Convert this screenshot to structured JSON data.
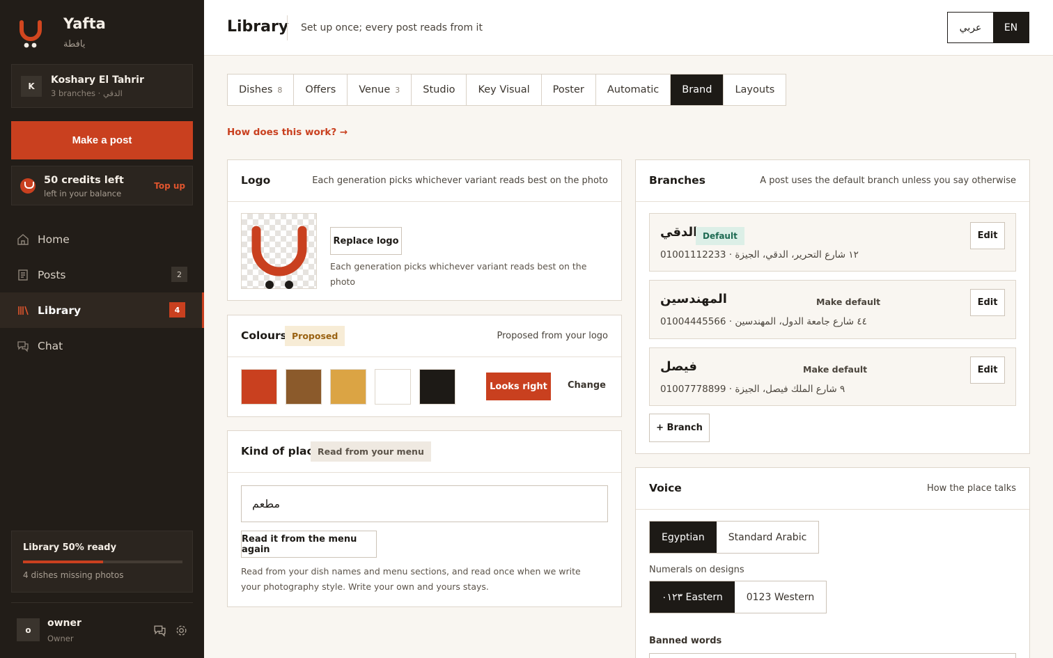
{
  "brand": {
    "name": "Yafta",
    "arabic": "يافطة"
  },
  "account": {
    "initial": "K",
    "name": "Koshary El Tahrir",
    "meta": "3 branches · الدقي"
  },
  "make_post": "Make a post",
  "credits": {
    "title": "50 credits left",
    "subtitle": "left in your balance",
    "topup": "Top up"
  },
  "nav": [
    {
      "label": "Home",
      "icon": "home-icon",
      "badge": ""
    },
    {
      "label": "Posts",
      "icon": "posts-icon",
      "badge": "2"
    },
    {
      "label": "Library",
      "icon": "library-icon",
      "badge": "4",
      "active": true
    },
    {
      "label": "Chat",
      "icon": "chat-icon",
      "badge": ""
    }
  ],
  "library_progress": {
    "title": "Library 50% ready",
    "percent": 50,
    "subtitle": "4 dishes missing photos"
  },
  "user": {
    "initial": "o",
    "name": "owner",
    "role": "Owner"
  },
  "header": {
    "title": "Library",
    "subtitle": "Set up once; every post reads from it",
    "lang_ar": "عربي",
    "lang_en": "EN"
  },
  "tabs": [
    {
      "label": "Dishes",
      "count": "8"
    },
    {
      "label": "Offers",
      "count": ""
    },
    {
      "label": "Venue",
      "count": "3"
    },
    {
      "label": "Studio",
      "count": ""
    },
    {
      "label": "Key Visual",
      "count": ""
    },
    {
      "label": "Poster",
      "count": ""
    },
    {
      "label": "Automatic",
      "count": ""
    },
    {
      "label": "Brand",
      "count": "",
      "active": true
    },
    {
      "label": "Layouts",
      "count": ""
    }
  ],
  "how_link": "How does this work? →",
  "logo": {
    "title": "Logo",
    "note": "Each generation picks whichever variant reads best on the photo",
    "replace": "Replace logo",
    "hint": "Each generation picks whichever variant reads best on the photo"
  },
  "colours": {
    "title": "Colours",
    "tag": "Proposed",
    "note": "Proposed from your logo",
    "swatches": [
      "#c9401f",
      "#8b5a2b",
      "#dba444",
      "#ffffff",
      "#1d1a16"
    ],
    "confirm": "Looks right",
    "change": "Change"
  },
  "kind": {
    "title": "Kind of place",
    "tag": "Read from your menu",
    "value": "مطعم",
    "reread": "Read it from the menu again",
    "hint": "Read from your dish names and menu sections, and read once when we write your photography style. Write your own and yours stays."
  },
  "branches": {
    "title": "Branches",
    "note": "A post uses the default branch unless you say otherwise",
    "default_label": "Default",
    "make_default": "Make default",
    "edit": "Edit",
    "items": [
      {
        "name": "الدقي",
        "address": "١٢ شارع التحرير، الدقي، الجيزة · 01001112233",
        "default": true
      },
      {
        "name": "المهندسين",
        "address": "٤٤ شارع جامعة الدول، المهندسين · 01004445566",
        "default": false
      },
      {
        "name": "فيصل",
        "address": "٩ شارع الملك فيصل، الجيزة · 01007778899",
        "default": false
      }
    ],
    "add": "+ Branch"
  },
  "voice": {
    "title": "Voice",
    "note": "How the place talks",
    "options": [
      "Egyptian",
      "Standard Arabic"
    ],
    "selected": 0,
    "numerals_label": "Numerals on designs",
    "numerals": [
      "٠١٢٣ Eastern",
      "0123 Western"
    ],
    "numerals_selected": 0,
    "banned_label": "Banned words"
  },
  "colors": {
    "accent": "#c9401f",
    "sidebar": "#221d18",
    "background": "#f9f6f1"
  }
}
